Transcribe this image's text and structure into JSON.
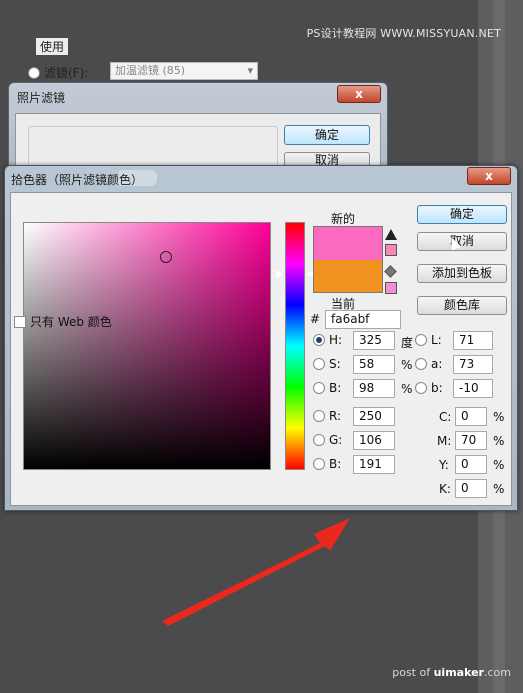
{
  "watermark_top": "PS设计教程网  WWW.MISSYUAN.NET",
  "watermark_bottom": {
    "prefix": "post of ",
    "brand": "uimaker",
    "suffix": ".com"
  },
  "photo_filter": {
    "title": "照片滤镜",
    "close": "x",
    "group_label": "使用",
    "filter_label": "滤镜(F):",
    "filter_value": "加温滤镜 (85)",
    "ok": "确定",
    "cancel": "取消"
  },
  "color_picker": {
    "title": "拾色器（照片滤镜颜色）",
    "close": "x",
    "new_label": "新的",
    "current_label": "当前",
    "new_color": "#fa6abf",
    "current_color": "#f0921f",
    "warning_swatch": "#f28ab4",
    "websafe_swatch": "#f58ed0",
    "buttons": {
      "ok": "确定",
      "cancel": "取消",
      "add_swatch": "添加到色板",
      "libraries": "颜色库"
    },
    "hsb": [
      {
        "label": "H:",
        "value": "325",
        "unit": "度",
        "selected": true
      },
      {
        "label": "S:",
        "value": "58",
        "unit": "%",
        "selected": false
      },
      {
        "label": "B:",
        "value": "98",
        "unit": "%",
        "selected": false
      }
    ],
    "rgb": [
      {
        "label": "R:",
        "value": "250"
      },
      {
        "label": "G:",
        "value": "106"
      },
      {
        "label": "B:",
        "value": "191"
      }
    ],
    "lab": [
      {
        "label": "L:",
        "value": "71"
      },
      {
        "label": "a:",
        "value": "73"
      },
      {
        "label": "b:",
        "value": "-10"
      }
    ],
    "cmyk": [
      {
        "label": "C:",
        "value": "0",
        "unit": "%"
      },
      {
        "label": "M:",
        "value": "70",
        "unit": "%"
      },
      {
        "label": "Y:",
        "value": "0",
        "unit": "%"
      },
      {
        "label": "K:",
        "value": "0",
        "unit": "%"
      }
    ],
    "web_only_label": "只有 Web 颜色",
    "hash": "#",
    "hex_value": "fa6abf"
  },
  "annotation_arrow_color": "#e8291c"
}
